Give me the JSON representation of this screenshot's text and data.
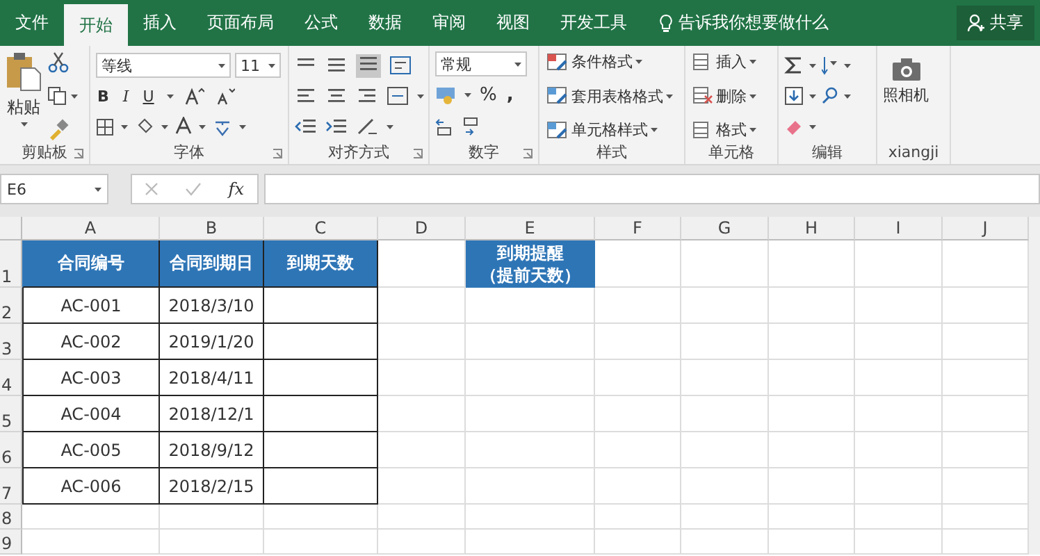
{
  "tabs": [
    {
      "label": "文件",
      "selected": false
    },
    {
      "label": "开始",
      "selected": true
    },
    {
      "label": "插入",
      "selected": false
    },
    {
      "label": "页面布局",
      "selected": false
    },
    {
      "label": "公式",
      "selected": false
    },
    {
      "label": "数据",
      "selected": false
    },
    {
      "label": "审阅",
      "selected": false
    },
    {
      "label": "视图",
      "selected": false
    },
    {
      "label": "开发工具",
      "selected": false
    }
  ],
  "tell_me": "告诉我你想要做什么",
  "share_button": "共享",
  "ribbon": {
    "clipboard": {
      "paste": "粘贴",
      "label": "剪贴板"
    },
    "font": {
      "font_name": "等线",
      "font_size": "11",
      "bold": "B",
      "italic": "I",
      "underline": "U",
      "label": "字体"
    },
    "alignment": {
      "label": "对齐方式"
    },
    "number": {
      "format": "常规",
      "percent": "%",
      "comma": ",",
      "label": "数字"
    },
    "styles": {
      "items": [
        "条件格式",
        "套用表格格式",
        "单元格样式"
      ],
      "label": "样式"
    },
    "cells": {
      "items": [
        "插入",
        "删除",
        "格式"
      ],
      "label": "单元格"
    },
    "editing": {
      "label": "编辑"
    },
    "camera": {
      "button": "照相机",
      "label": "xiangji"
    }
  },
  "formula_bar": {
    "name_box": "E6",
    "function_button": "fx"
  },
  "columns": [
    "A",
    "B",
    "C",
    "D",
    "E",
    "F",
    "G",
    "H",
    "I",
    "J"
  ],
  "row_numbers": [
    "1",
    "2",
    "3",
    "4",
    "5",
    "6",
    "7",
    "8",
    "9"
  ],
  "table": {
    "header": [
      "合同编号",
      "合同到期日",
      "到期天数"
    ],
    "rows": [
      [
        "AC-001",
        "2018/3/10"
      ],
      [
        "AC-002",
        "2019/1/20"
      ],
      [
        "AC-003",
        "2018/4/11"
      ],
      [
        "AC-004",
        "2018/12/1"
      ],
      [
        "AC-005",
        "2018/9/12"
      ],
      [
        "AC-006",
        "2018/2/15"
      ]
    ]
  },
  "reminder_header": [
    "到期提醒",
    "（提前天数）"
  ]
}
